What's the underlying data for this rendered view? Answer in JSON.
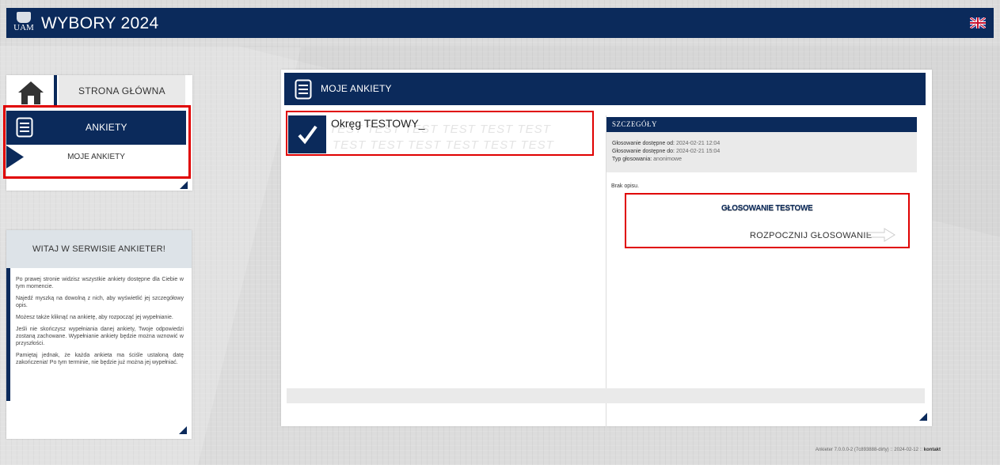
{
  "app": {
    "logo_text": "UAM",
    "title": "WYBORY 2024",
    "language_flag": "uk-flag-icon"
  },
  "nav": {
    "home_label": "STRONA GŁÓWNA",
    "ankiety_label": "ANKIETY",
    "moje_ankiety_label": "MOJE ANKIETY"
  },
  "welcome": {
    "title": "WITAJ W SERWISIE ANKIETER!",
    "paragraphs": [
      "Po prawej stronie widzisz wszystkie ankiety dostępne dla Ciebie w tym momencie.",
      "Najedź myszką na dowolną z nich, aby wyświetlić jej szczegółowy opis.",
      "Możesz także kliknąć na ankietę, aby rozpocząć jej wypełnianie.",
      "Jeśli nie skończysz wypełniania danej ankiety, Twoje odpowiedzi zostaną zachowane. Wypełnianie ankiety będzie można wznowić w przyszłości.",
      "Pamiętaj jednak, że każda ankieta ma ściśle ustaloną datę zakończenia! Po tym terminie, nie będzie już można jej wypełniać."
    ]
  },
  "main": {
    "title": "MOJE ANKIETY",
    "survey": {
      "name": "Okręg TESTOWY_",
      "watermark": "TEST TEST TEST TEST TEST TEST"
    },
    "details": {
      "header": "SZCZEGÓŁY",
      "from_label": "Głosowanie dostępne od:",
      "from_value": "2024-02-21 12:04",
      "to_label": "Głosowanie dostępne do:",
      "to_value": "2024-02-21 15:04",
      "type_label": "Typ głosowania:",
      "type_value": "anonimowe",
      "description": "Brak opisu."
    },
    "vote": {
      "title": "GŁOSOWANIE TESTOWE",
      "start_label": "ROZPOCZNIJ GŁOSOWANIE"
    }
  },
  "footer": {
    "version": "Ankieter 7.0.0.0-2 (7c893888-dirty) :: 2024-02-12 ::",
    "contact": "kontakt"
  },
  "colors": {
    "brand_navy": "#0b2a5b",
    "highlight_red": "#e00000"
  }
}
